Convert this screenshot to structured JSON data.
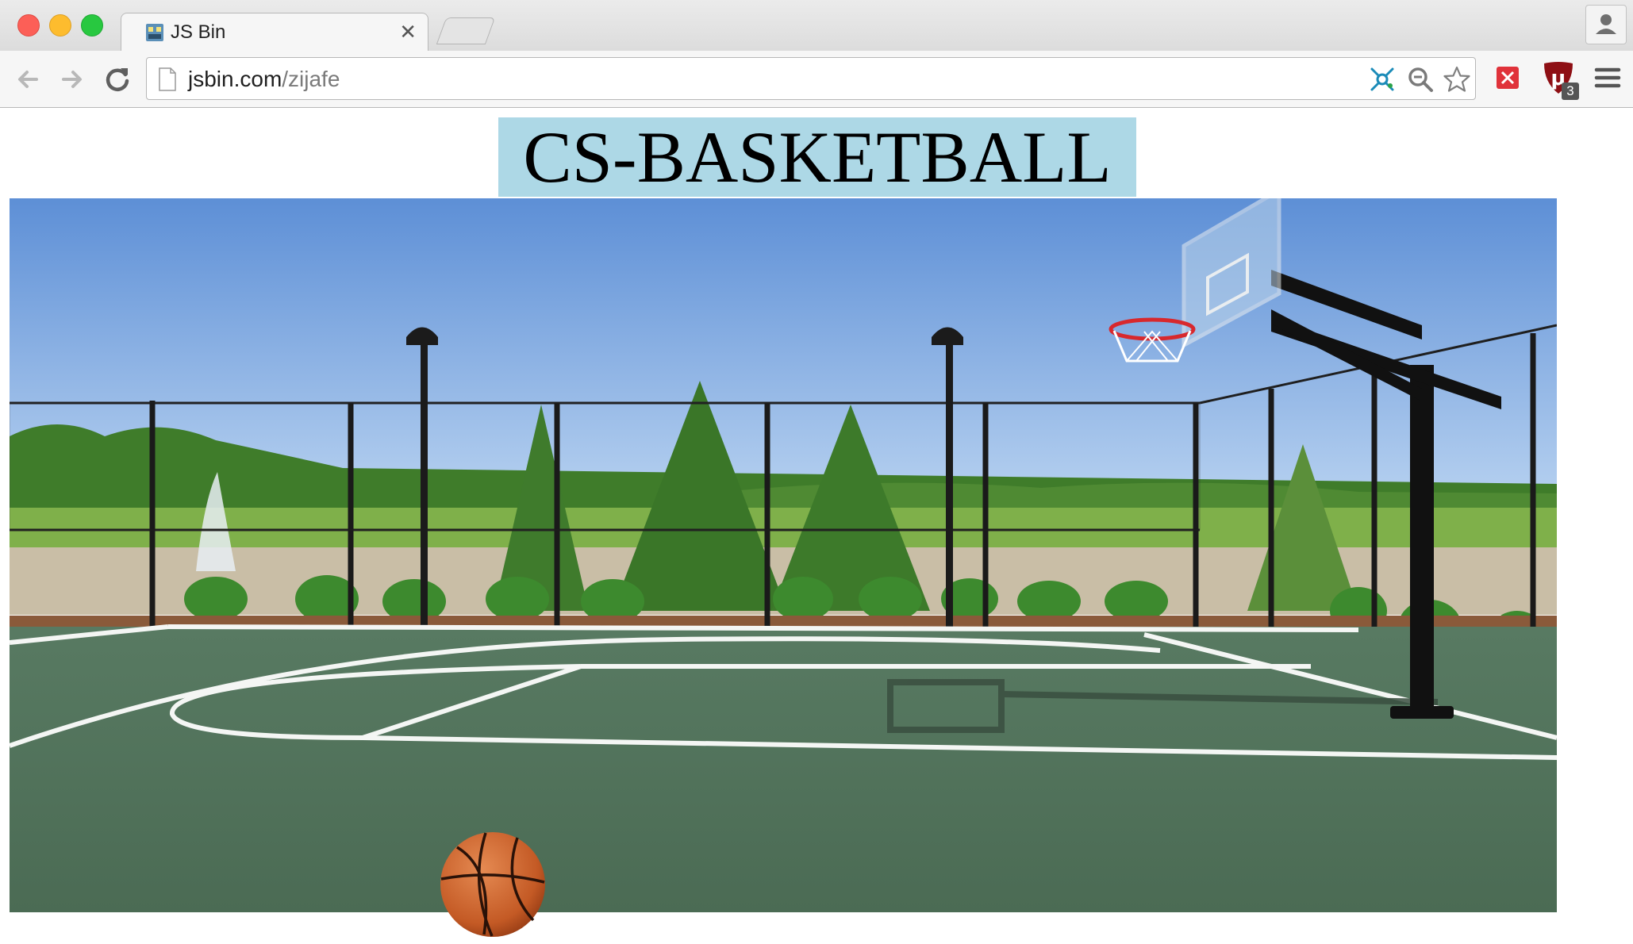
{
  "browser": {
    "tab": {
      "title": "JS Bin",
      "close_glyph": "✕"
    },
    "address_bar": {
      "host": "jsbin.com",
      "path": "/zijafe"
    },
    "icons": {
      "back": "arrow-left-icon",
      "forward": "arrow-right-icon",
      "reload": "reload-icon",
      "page": "page-icon",
      "extension_1": "molecule-extension-icon",
      "zoom": "zoom-out-icon",
      "bookmark": "star-icon",
      "extension_2": "red-x-extension-icon",
      "ublock": "ublock-icon",
      "menu": "hamburger-menu-icon",
      "profile": "person-icon"
    },
    "ublock_badge": "3"
  },
  "page": {
    "heading": "CS-BASKETBALL",
    "heading_bg": "#add8e6"
  }
}
